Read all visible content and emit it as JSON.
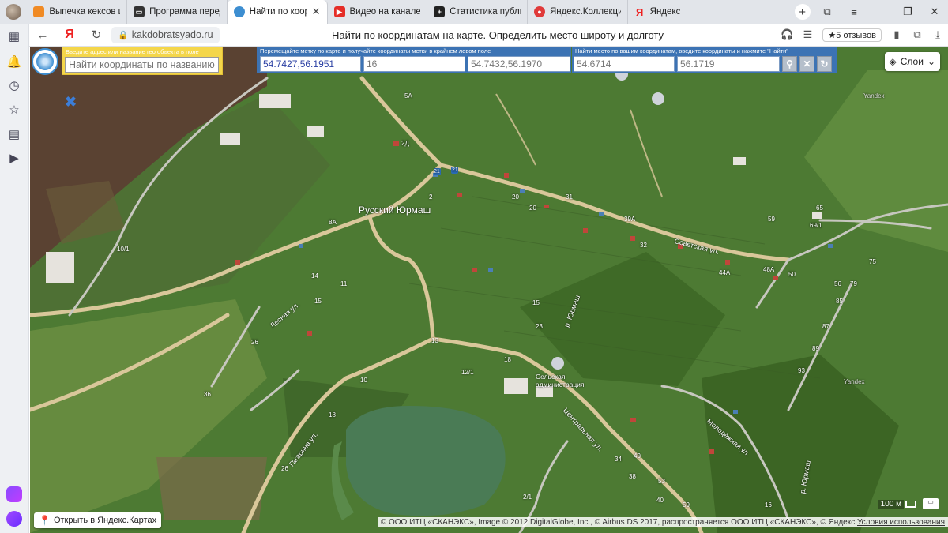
{
  "browser": {
    "tabs": [
      {
        "title": "Выпечка кексов и т...",
        "fav": "orange",
        "active": false
      },
      {
        "title": "Программа передач",
        "fav": "tv",
        "active": false
      },
      {
        "title": "Найти по координ",
        "fav": "globe",
        "active": true
      },
      {
        "title": "Видео на канале - Yo",
        "fav": "youtube",
        "active": false
      },
      {
        "title": "Статистика публикац",
        "fav": "plus",
        "active": false
      },
      {
        "title": "Яндекс.Коллекции",
        "fav": "collections",
        "active": false
      },
      {
        "title": "Яндекс",
        "fav": "yandex",
        "active": false
      }
    ],
    "new_tab": "+",
    "address": {
      "url": "kakdobratsyado.ru",
      "page_title": "Найти по координатам на карте. Определить место широту и долготу",
      "reviews": "★5 отзывов"
    }
  },
  "map_ui": {
    "address_panel": {
      "hint": "Введите адрес или название гео объекта в поле",
      "placeholder": "Найти координаты по названию"
    },
    "coord_panel": {
      "hint": "Перемещайте метку по карте и получайте координаты метки в крайнем левом поле",
      "marker_coords": "54.7427,56.1951",
      "zoom": "16",
      "corner_coords": "54.7432,56.1970"
    },
    "search_panel": {
      "hint": "Найти место по вашим координатам, введите координаты и нажмите \"Найти\"",
      "lat": "54.6714",
      "lon": "56.1719"
    },
    "layers_label": "Слои",
    "open_in_yandex": "Открыть в Яндекс.Картах",
    "copyright": "© ООО ИТЦ «СКАНЭКС», Image © 2012 DigitalGlobe, Inc., © Airbus DS 2017, распространяется ООО ИТЦ «СКАНЭКС», © Яндекс",
    "terms": "Условия использования",
    "scale": "100 м"
  },
  "map_labels": {
    "village": "Русский Юрмаш",
    "streets": [
      "Советская ул.",
      "Центральная ул.",
      "Лесная ул.",
      "Гагарина ул.",
      "Молодёжная ул.",
      "р. Юрмаш",
      "р. Юрмаш"
    ],
    "poi": "Сельская администрация",
    "watermarks": [
      "Yandex",
      "Yandex"
    ],
    "houses": [
      "5А",
      "2Д",
      "21",
      "21",
      "2",
      "8А",
      "20",
      "31",
      "20",
      "39А",
      "32",
      "59",
      "65",
      "69/1",
      "75",
      "48А",
      "44А",
      "50",
      "56",
      "79",
      "85",
      "87",
      "89",
      "93",
      "10/1",
      "14",
      "11",
      "15",
      "26",
      "36",
      "12/1",
      "10",
      "13",
      "18",
      "18",
      "23",
      "15",
      "34",
      "38",
      "49",
      "53",
      "40",
      "59",
      "16",
      "26",
      "2/1"
    ]
  },
  "colors": {
    "coord_panel": "#3c73b4",
    "address_panel": "#f4d64a",
    "road": "#d9c79a",
    "lake": "#4a7b55"
  }
}
